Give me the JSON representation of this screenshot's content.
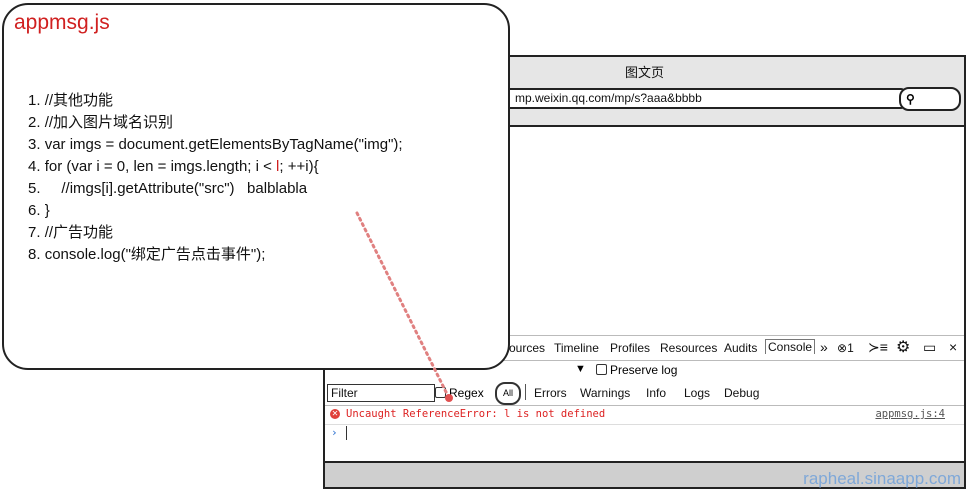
{
  "callout": {
    "filename": "appmsg.js",
    "code_lines": [
      {
        "num": "1.",
        "text": "//其他功能"
      },
      {
        "num": "2.",
        "text": "//加入图片域名识别"
      },
      {
        "num": "3.",
        "text": "var imgs = document.getElementsByTagName(\"img\");"
      },
      {
        "num": "4.",
        "pre": "for (var i = 0, len = imgs.length; i < ",
        "highlight": "l",
        "post": "; ++i){"
      },
      {
        "num": "5.",
        "text": "    //imgs[i].getAttribute(\"src\")   balblabla"
      },
      {
        "num": "6.",
        "text": "}"
      },
      {
        "num": "7.",
        "text": "//广告功能"
      },
      {
        "num": "8.",
        "text": "console.log(\"绑定广告点击事件\");"
      }
    ],
    "accent_color": "#d02020"
  },
  "browser": {
    "title": "图文页",
    "url": "mp.weixin.qq.com/mp/s?aaa&bbbb",
    "search_icon": "magnifier-icon"
  },
  "devtools": {
    "tabs": [
      "Sources",
      "Timeline",
      "Profiles",
      "Resources",
      "Audits",
      "Console"
    ],
    "tab_visible": [
      "ources",
      "Timeline",
      "Profiles",
      "Resources",
      "Audits",
      "Console"
    ],
    "more": "»",
    "error_count": "1",
    "close": "×",
    "preserve_log": "Preserve log",
    "filter_placeholder": "Filter",
    "regex_label": "Regex",
    "all_label": "All",
    "filter_levels": [
      "Errors",
      "Warnings",
      "Info",
      "Logs",
      "Debug"
    ],
    "error_message": "Uncaught ReferenceError: l is not defined",
    "error_source": "appmsg.js:4",
    "prompt": "›"
  },
  "watermark": "rapheal.sinaapp.com"
}
